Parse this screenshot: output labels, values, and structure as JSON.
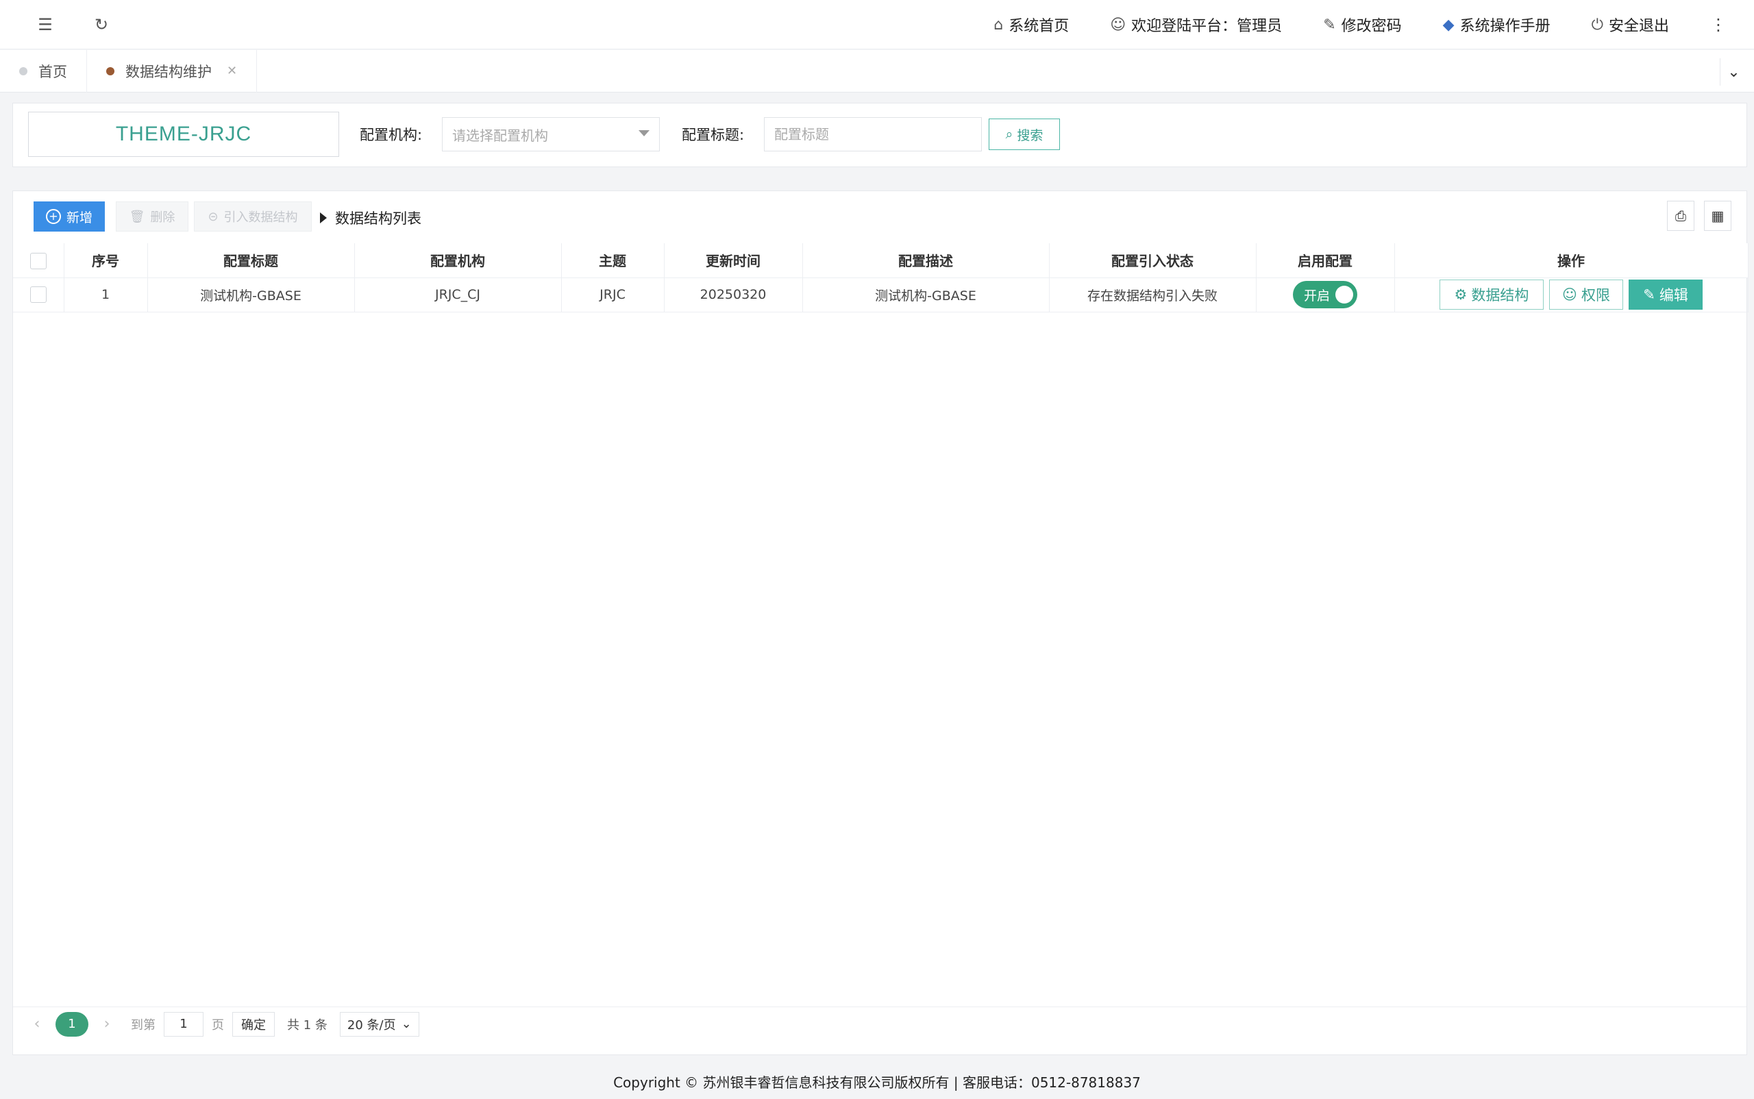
{
  "topbar": {
    "home": "系统首页",
    "welcome": "欢迎登陆平台：管理员",
    "change_password": "修改密码",
    "manual": "系统操作手册",
    "logout": "安全退出"
  },
  "tabs": [
    {
      "label": "首页"
    },
    {
      "label": "数据结构维护"
    }
  ],
  "search": {
    "theme": "THEME-JRJC",
    "org_label": "配置机构:",
    "org_placeholder": "请选择配置机构",
    "title_label": "配置标题:",
    "title_placeholder": "配置标题",
    "search_button": "搜索"
  },
  "toolbar": {
    "add": "新增",
    "delete": "删除",
    "import": "引入数据结构",
    "list_title": "数据结构列表"
  },
  "table": {
    "headers": [
      "序号",
      "配置标题",
      "配置机构",
      "主题",
      "更新时间",
      "配置描述",
      "配置引入状态",
      "启用配置",
      "操作"
    ],
    "rows": [
      {
        "index": "1",
        "title": "测试机构-GBASE",
        "org": "JRJC_CJ",
        "theme": "JRJC",
        "updated": "20250320",
        "desc": "测试机构-GBASE",
        "import_status": "存在数据结构引入失败",
        "enabled_label": "开启",
        "actions": {
          "structure": "数据结构",
          "permission": "权限",
          "edit": "编辑"
        }
      }
    ]
  },
  "pager": {
    "current": "1",
    "goto_prefix": "到第",
    "goto_value": "1",
    "goto_suffix": "页",
    "confirm": "确定",
    "total": "共 1 条",
    "page_size": "20 条/页"
  },
  "footer": "Copyright © 苏州银丰睿哲信息科技有限公司版权所有 | 客服电话：0512-87818837",
  "colors": {
    "accent": "#3aa090",
    "primary": "#3a8ee6",
    "danger": "#e03a3a",
    "switch_on": "#32a37a"
  }
}
